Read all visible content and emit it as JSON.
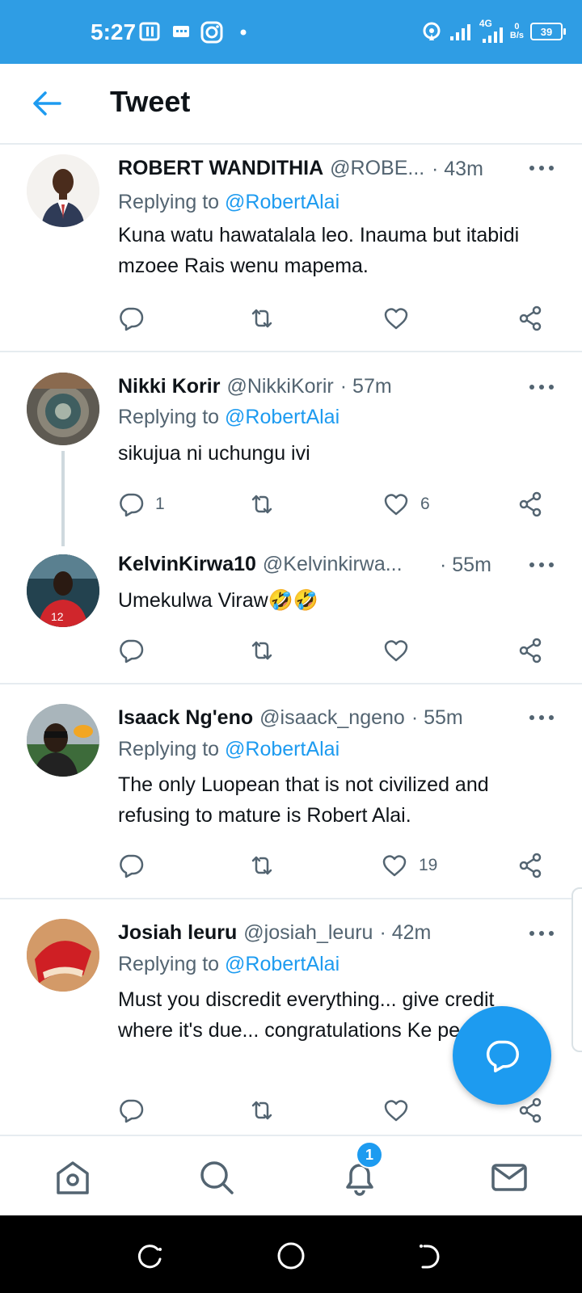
{
  "status_bar": {
    "time": "5:27",
    "network": "4G",
    "speed_value": "0",
    "speed_unit": "B/s",
    "battery": "39"
  },
  "header": {
    "title": "Tweet"
  },
  "colors": {
    "accent": "#1d9bf0",
    "status_bar": "#2f9de4"
  },
  "tweets": [
    {
      "name": "ROBERT WANDITHIA",
      "handle": "@ROBE...",
      "time": "· 43m",
      "replying_label": "Replying to ",
      "replying_to": "@RobertAlai",
      "text": "Kuna watu hawatalala leo. Inauma but itabidi mzoee Rais wenu mapema.",
      "replies": "",
      "likes": ""
    },
    {
      "name": "Nikki Korir",
      "handle": "@NikkiKorir",
      "time": "· 57m",
      "replying_label": "Replying to ",
      "replying_to": "@RobertAlai",
      "text": "sikujua ni uchungu ivi",
      "replies": "1",
      "likes": "6"
    },
    {
      "name": "KelvinKirwa10",
      "handle": "@Kelvinkirwa...",
      "time": "· 55m",
      "text": "Umekulwa Viraw🤣🤣",
      "replies": "",
      "likes": ""
    },
    {
      "name": "Isaack Ng'eno",
      "handle": "@isaack_ngeno",
      "time": "· 55m",
      "replying_label": "Replying to ",
      "replying_to": "@RobertAlai",
      "text": "The only Luopean that is not civilized and refusing to mature is Robert Alai.",
      "replies": "",
      "likes": "19"
    },
    {
      "name": "Josiah leuru",
      "handle": "@josiah_leuru",
      "time": "· 42m",
      "replying_label": "Replying to ",
      "replying_to": "@RobertAlai",
      "text": "Must you discredit everything... give credit where it's due... congratulations Ke people",
      "replies": "",
      "likes": ""
    }
  ],
  "bottom_nav": {
    "notifications_badge": "1"
  },
  "icons": [
    "back-arrow-icon",
    "more-icon",
    "reply-icon",
    "retweet-icon",
    "like-icon",
    "share-icon",
    "compose-reply-icon",
    "home-icon",
    "search-icon",
    "notifications-icon",
    "messages-icon"
  ]
}
